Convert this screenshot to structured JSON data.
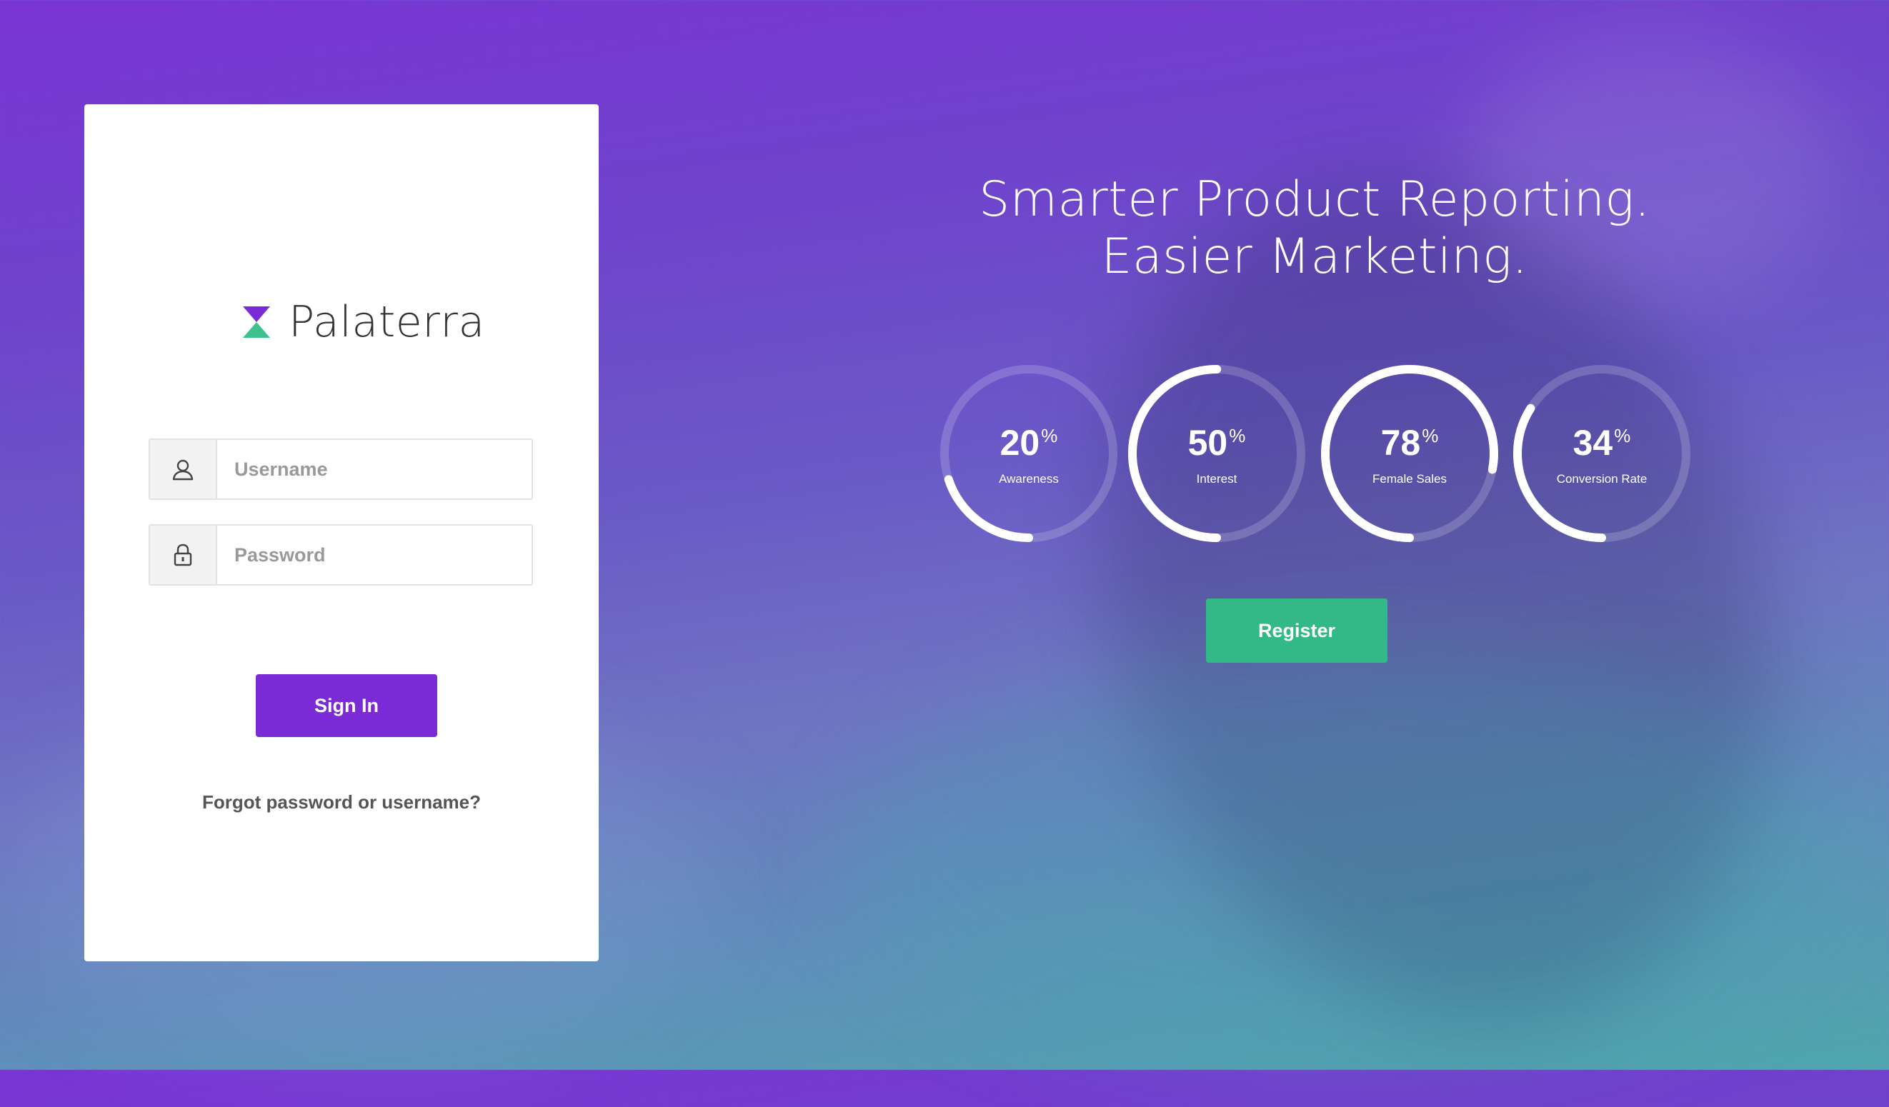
{
  "brand": {
    "name": "Palaterra",
    "colors": {
      "top": "#7b2bd6",
      "bottom": "#3ec08f"
    }
  },
  "login": {
    "username": {
      "placeholder": "Username",
      "value": "",
      "icon": "user-icon"
    },
    "password": {
      "placeholder": "Password",
      "value": "",
      "icon": "lock-icon"
    },
    "sign_in_label": "Sign In",
    "forgot_label": "Forgot password or username?"
  },
  "hero": {
    "headline_line1": "Smarter Product Reporting.",
    "headline_line2": "Easier Marketing.",
    "stats": [
      {
        "value": "20",
        "unit": "%",
        "label": "Awareness",
        "percent": 20
      },
      {
        "value": "50",
        "unit": "%",
        "label": "Interest",
        "percent": 50
      },
      {
        "value": "78",
        "unit": "%",
        "label": "Female Sales",
        "percent": 78
      },
      {
        "value": "34",
        "unit": "%",
        "label": "Conversion Rate",
        "percent": 34
      }
    ],
    "register_label": "Register"
  },
  "colors": {
    "primary_button": "#7b2bd6",
    "register_button": "#33b887",
    "gauge_track": "rgba(255,255,255,0.18)",
    "gauge_fill": "#ffffff"
  }
}
